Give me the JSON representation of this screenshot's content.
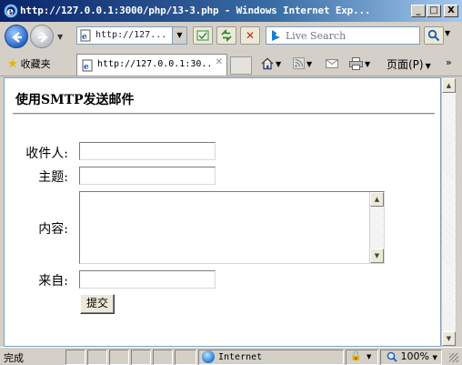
{
  "window": {
    "title": "http://127.0.0.1:3000/php/13-3.php - Windows Internet Exp...",
    "minimize": "_",
    "maximize": "□",
    "close": "X"
  },
  "navbar": {
    "address_value": "http://127...",
    "search_placeholder": "Live Search"
  },
  "favbar": {
    "favorites_label": "收藏夹",
    "tab_title": "http://127.0.0.1:30...",
    "page_menu": "页面(P)"
  },
  "page": {
    "heading": "使用SMTP发送邮件",
    "form": {
      "to_label": "收件人:",
      "subject_label": "主题:",
      "content_label": "内容:",
      "from_label": "来自:",
      "to_value": "",
      "subject_value": "",
      "content_value": "",
      "from_value": "",
      "submit_label": "提交"
    }
  },
  "statusbar": {
    "status_text": "完成",
    "zone": "Internet",
    "zoom": "100%"
  },
  "colors": {
    "titlebar_start": "#0a246a",
    "chrome": "#d4d0c8",
    "content_bg": "#ffffff"
  }
}
